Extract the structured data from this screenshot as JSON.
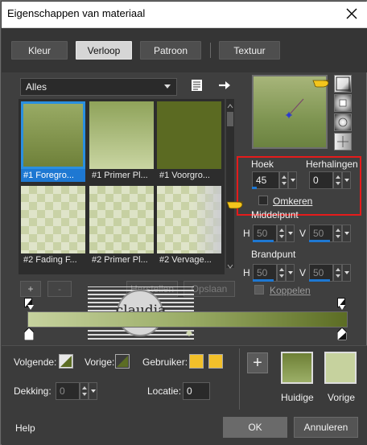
{
  "window": {
    "title": "Eigenschappen van materiaal"
  },
  "tabs": [
    {
      "label": "Kleur",
      "active": false
    },
    {
      "label": "Verloop",
      "active": true
    },
    {
      "label": "Patroon",
      "active": false
    },
    {
      "label": "Textuur",
      "active": false
    }
  ],
  "gallery": {
    "category": "Alles",
    "items": [
      {
        "label": "#1 Foregro...",
        "selected": true,
        "swatch": "gradient-olive-light"
      },
      {
        "label": "#1 Primer Pl...",
        "selected": false,
        "swatch": "gradient-olive-soft"
      },
      {
        "label": "#1 Voorgro...",
        "selected": false,
        "swatch": "solid-olive-dark"
      },
      {
        "label": "#2 Fading F...",
        "selected": false,
        "swatch": "checker-fade"
      },
      {
        "label": "#2 Primer Pl...",
        "selected": false,
        "swatch": "checker-fade"
      },
      {
        "label": "#2 Vervage...",
        "selected": false,
        "swatch": "checker-fade"
      }
    ]
  },
  "gallery_buttons": {
    "add": "+",
    "remove": "-",
    "restore": "Herstellen",
    "save": "Opslaan"
  },
  "settings": {
    "angle_label": "Hoek",
    "angle_value": "45",
    "repeats_label": "Herhalingen",
    "repeats_value": "0",
    "invert_label": "Omkeren",
    "invert_checked": false,
    "center_label": "Middelpunt",
    "center_h_label": "H",
    "center_h_value": "50",
    "center_v_label": "V",
    "center_v_value": "50",
    "focus_label": "Brandpunt",
    "focus_h_label": "H",
    "focus_h_value": "50",
    "focus_v_label": "V",
    "focus_v_value": "50",
    "link_label": "Koppelen",
    "link_checked": false
  },
  "gradient_bar": {
    "start_color": "#c6d29e",
    "end_color": "#5c6d24"
  },
  "watermark": {
    "text": "claudia"
  },
  "bottom": {
    "next_label": "Volgende:",
    "previous_label": "Vorige:",
    "user_label": "Gebruiker:",
    "user_colors": [
      "#f2c02a",
      "#f2c02a"
    ],
    "opacity_label": "Dekking:",
    "opacity_value": "0",
    "location_label": "Locatie:",
    "location_value": "0",
    "current_label": "Huidige",
    "previous_swatch_label": "Vorige",
    "add_symbol": "+"
  },
  "footer": {
    "help": "Help",
    "ok": "OK",
    "cancel": "Annuleren"
  },
  "colors": {
    "accent": "#1e78d2",
    "highlight_box": "#e51b1b",
    "olive_dark": "#5c6d24",
    "olive_light": "#c6d29e"
  }
}
